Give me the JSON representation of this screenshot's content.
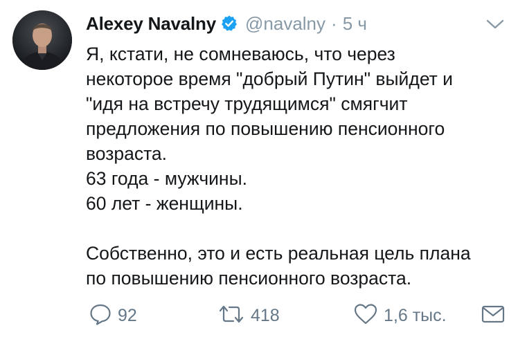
{
  "tweet": {
    "author": {
      "display_name": "Alexey Navalny",
      "handle": "@navalny",
      "verified": true,
      "avatar_icon": "user-photo"
    },
    "separator": "·",
    "time": "5 ч",
    "menu_icon": "chevron-down-icon",
    "text_lines": [
      "Я, кстати, не сомневаюсь, что через",
      "некоторое время \"добрый Путин\" выйдет и",
      "\"идя на встречу трудящимся\" смягчит",
      "предложения по повышению пенсионного",
      "возраста.",
      "63 года - мужчины.",
      "60 лет - женщины.",
      "",
      "Собственно, это и есть реальная цель плана",
      "по повышению пенсионного возраста."
    ],
    "actions": {
      "reply_count": "92",
      "retweet_count": "418",
      "like_count": "1,6 тыс."
    }
  },
  "colors": {
    "text": "#14171a",
    "secondary": "#8899a6",
    "action": "#657786",
    "verified_blue": "#1da1f2"
  }
}
